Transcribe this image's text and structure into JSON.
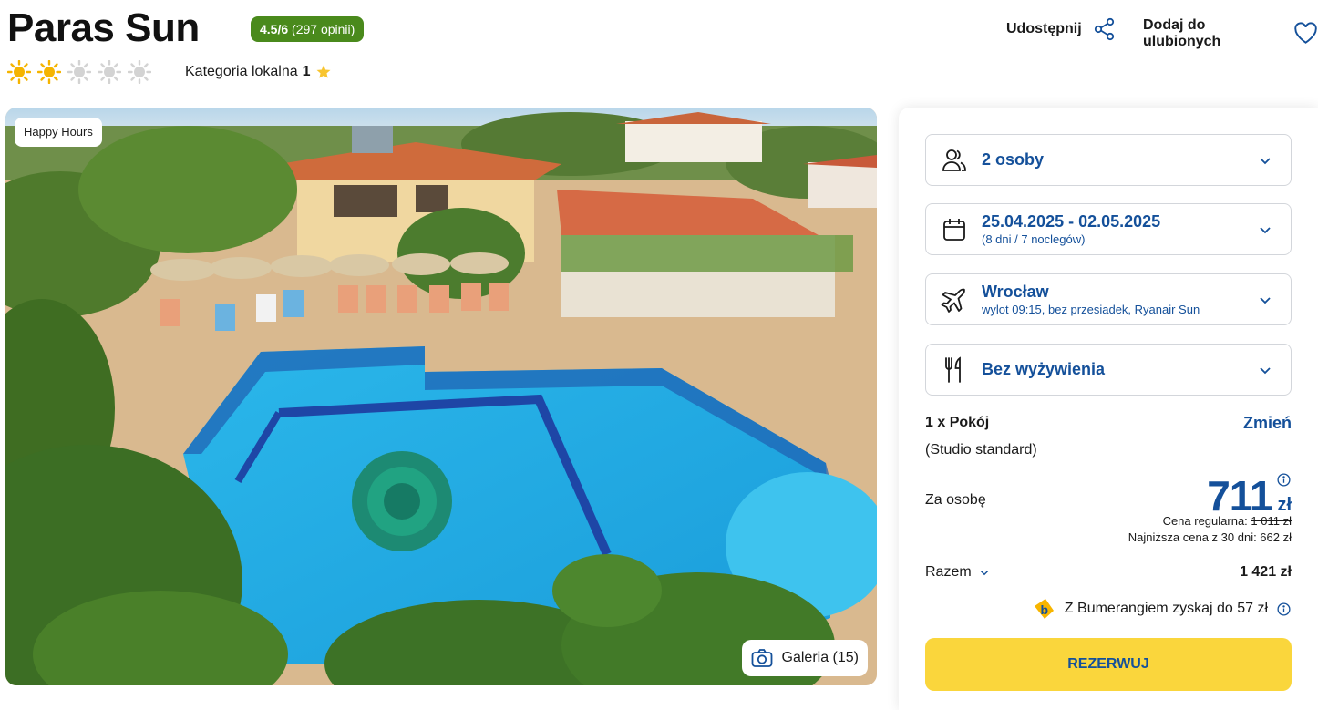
{
  "hotel": {
    "name": "Paras Sun",
    "rating_score": "4.5/6",
    "rating_count": "(297 opinii)",
    "suns_filled": 2,
    "suns_total": 5,
    "category_label": "Kategoria lokalna",
    "category_value": "1"
  },
  "actions": {
    "share_label": "Udostępnij",
    "favorite_label": "Dodaj do ulubionych"
  },
  "photo": {
    "badge": "Happy Hours",
    "gallery_label": "Galeria (15)"
  },
  "booking": {
    "persons": "2 osoby",
    "dates": "25.04.2025 - 02.05.2025",
    "dates_sub": "(8 dni / 7 noclegów)",
    "departure_city": "Wrocław",
    "departure_sub": "wylot 09:15, bez przesiadek, Ryanair Sun",
    "board": "Bez wyżywienia",
    "room_count": "1 x Pokój",
    "change_label": "Zmień",
    "room_type": "(Studio standard)",
    "per_person_label": "Za osobę",
    "price_value": "711",
    "price_currency": "zł",
    "regular_label": "Cena regularna:",
    "regular_price": "1 011 zł",
    "lowest_price_text": "Najniższa cena z 30 dni: 662 zł",
    "total_label": "Razem",
    "total_value": "1 421 zł",
    "bumerang_text": "Z Bumerangiem zyskaj do 57 zł",
    "reserve_label": "REZERWUJ"
  },
  "colors": {
    "accent_blue": "#14509a",
    "rating_green": "#4a8a1c",
    "reserve_yellow": "#fad63c",
    "sun_active": "#f5b400",
    "sun_inactive": "#d3d3d3"
  },
  "icons": {
    "share": "share-icon",
    "favorite": "heart-icon",
    "persons": "users-icon",
    "dates": "calendar-icon",
    "flight": "plane-icon",
    "board": "fork-knife-icon",
    "gallery": "camera-icon",
    "info": "info-icon",
    "bumerang": "bumerang-logo"
  }
}
